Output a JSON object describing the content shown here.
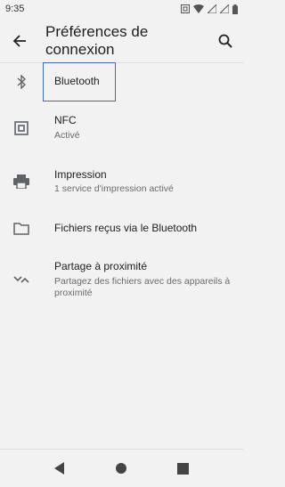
{
  "status_bar": {
    "time": "9:35"
  },
  "app_bar": {
    "title": "Préférences de connexion"
  },
  "items": [
    {
      "title": "Bluetooth",
      "subtitle": ""
    },
    {
      "title": "NFC",
      "subtitle": "Activé"
    },
    {
      "title": "Impression",
      "subtitle": "1 service d'impression activé"
    },
    {
      "title": "Fichiers reçus via le Bluetooth",
      "subtitle": ""
    },
    {
      "title": "Partage à proximité",
      "subtitle": "Partagez des fichiers avec des appareils à proximité"
    }
  ],
  "icons": {
    "back": "back-arrow-icon",
    "search": "search-icon",
    "bluetooth": "bluetooth-icon",
    "nfc": "nfc-icon",
    "print": "printer-icon",
    "folder": "folder-icon",
    "nearby": "nearby-share-icon"
  },
  "colors": {
    "focus": "#3e6ab1",
    "background": "#f2f2f2"
  }
}
